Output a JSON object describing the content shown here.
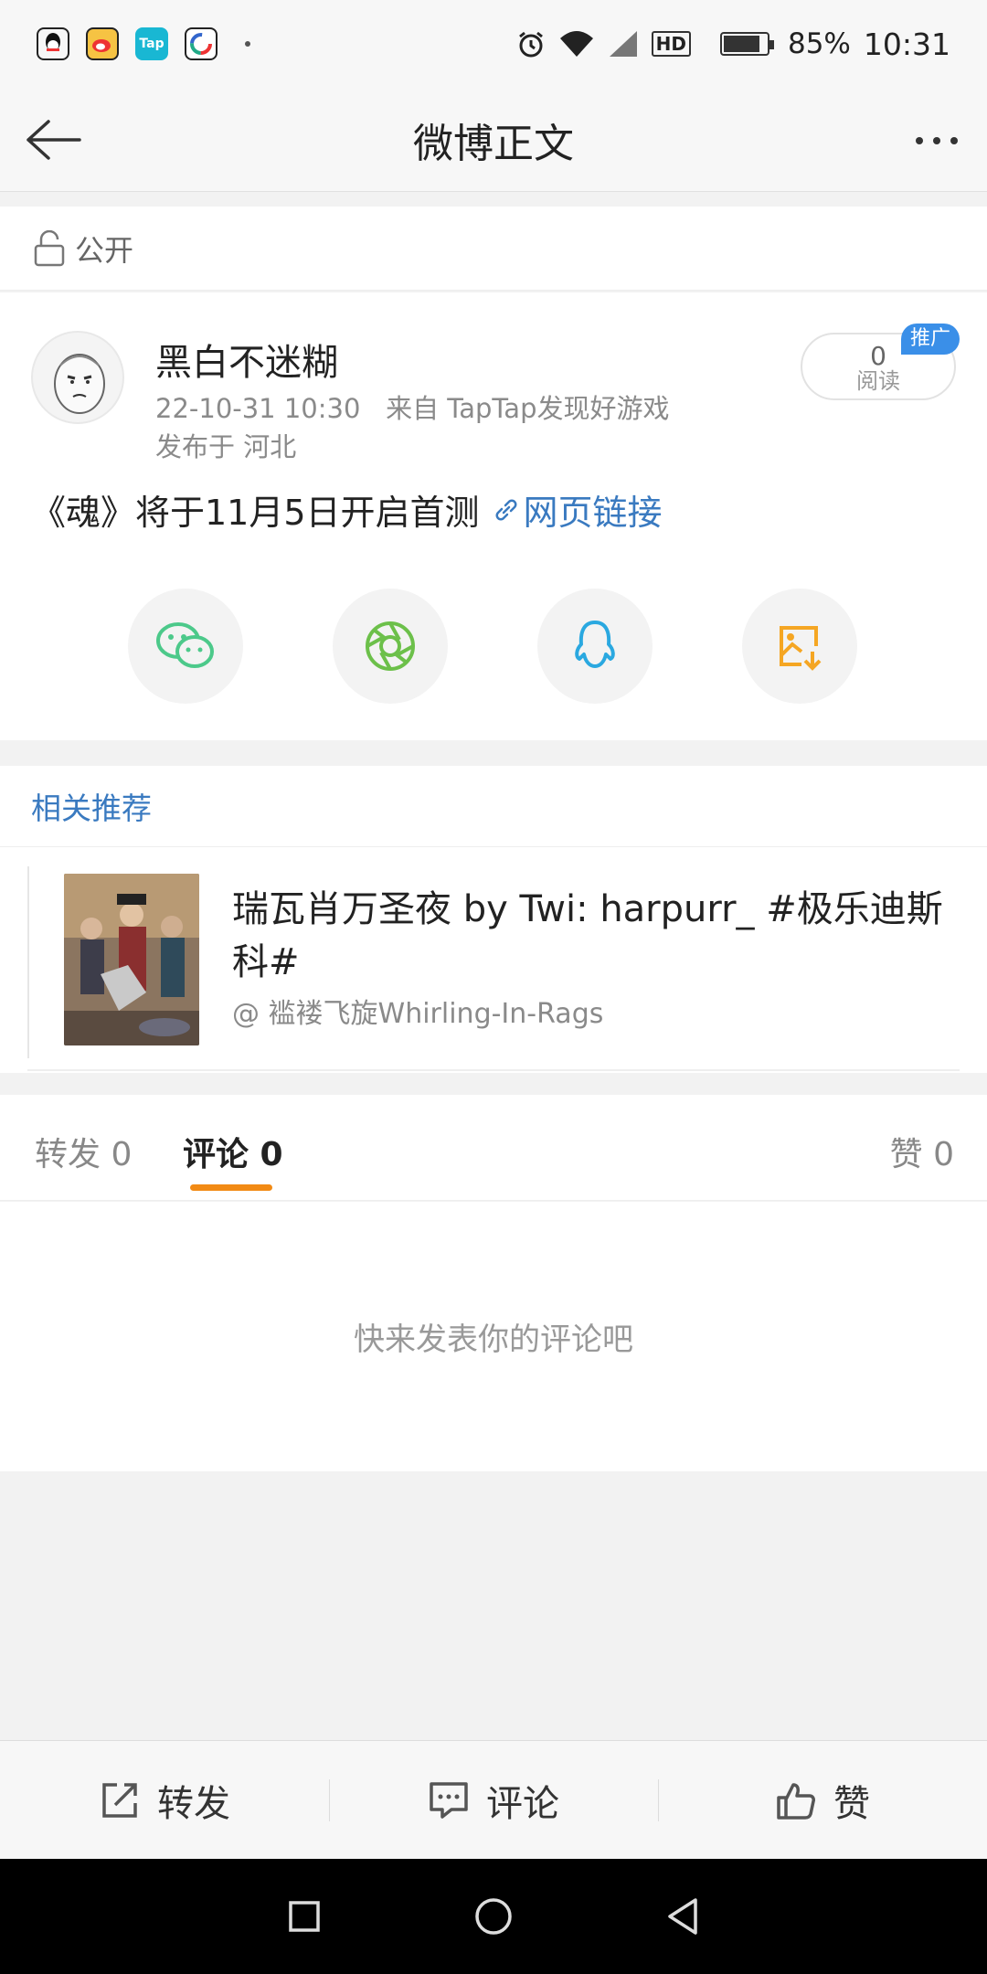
{
  "status_bar": {
    "apps": [
      "QQ",
      "Weibo",
      "Tap",
      "App"
    ],
    "battery": "85%",
    "time": "10:31",
    "network": "HD",
    "battery_level": 0.85
  },
  "header": {
    "title": "微博正文"
  },
  "privacy": {
    "label": "公开"
  },
  "post": {
    "author": "黑白不迷糊",
    "meta": "22-10-31 10:30   来自 TapTap发现好游戏",
    "location": "发布于 河北",
    "read_count": "0",
    "read_label": "阅读",
    "promo_badge": "推广",
    "text": "《魂》将于11月5日开启首测",
    "link_label": "网页链接"
  },
  "share": {
    "icons": [
      "wechat-icon",
      "moments-icon",
      "qq-icon",
      "save-image-icon"
    ],
    "colors": [
      "#4cc98a",
      "#6cc04a",
      "#2aa8e0",
      "#f5a623"
    ]
  },
  "related": {
    "title": "相关推荐",
    "item_title": "瑞瓦肖万圣夜 by Twi: harpurr_ #极乐迪斯科#",
    "item_source": "@ 褴褛飞旋Whirling-In-Rags"
  },
  "tabs": {
    "repost": "转发 0",
    "comment": "评论 0",
    "like": "赞 0",
    "accent": "#f28a14"
  },
  "comments": {
    "empty_text": "快来发表你的评论吧"
  },
  "actions": {
    "repost": "转发",
    "comment": "评论",
    "like": "赞"
  }
}
